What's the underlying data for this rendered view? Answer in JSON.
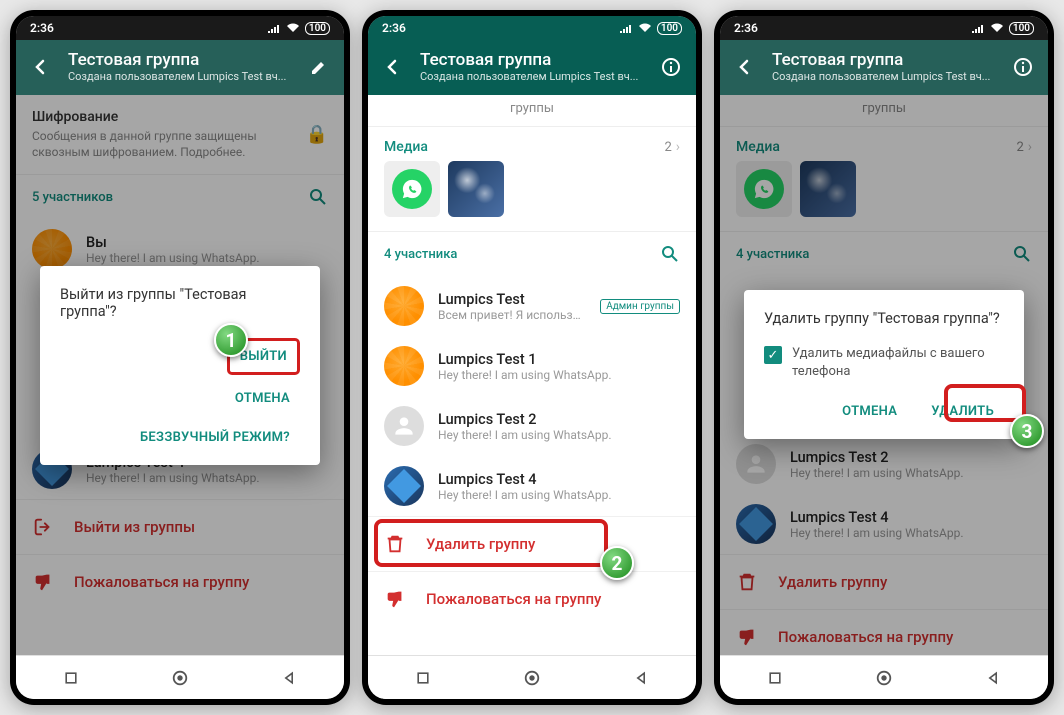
{
  "status": {
    "time": "2:36"
  },
  "header": {
    "title": "Тестовая группа",
    "subtitle": "Создана пользователем Lumpics Test вч..."
  },
  "encryption": {
    "title": "Шифрование",
    "text": "Сообщения в данной группе защищены сквозным шифрованием. Подробнее."
  },
  "groupLabel": "группы",
  "media": {
    "label": "Медиа",
    "count": "2"
  },
  "participants5": "5 участников",
  "participants4": "4 участника",
  "members": {
    "you": {
      "name": "Вы",
      "status": "Hey there! I am using WhatsApp."
    },
    "test": {
      "name": "Lumpics Test",
      "status": "Всем привет! Я использую WhatsApp."
    },
    "admin": "Админ группы",
    "test1": {
      "name": "Lumpics Test 1",
      "status": "Hey there! I am using WhatsApp."
    },
    "test2": {
      "name": "Lumpics Test 2",
      "status": "Hey there! I am using WhatsApp."
    },
    "test4": {
      "name": "Lumpics Test 4",
      "status": "Hey there! I am using WhatsApp."
    }
  },
  "actions": {
    "exit": "Выйти из группы",
    "delete": "Удалить группу",
    "report": "Пожаловаться на группу"
  },
  "dialog1": {
    "text": "Выйти из группы \"Тестовая группа\"?",
    "exit": "ВЫЙТИ",
    "cancel": "ОТМЕНА",
    "mute": "БЕЗЗВУЧНЫЙ РЕЖИМ?"
  },
  "dialog3": {
    "text": "Удалить группу \"Тестовая группа\"?",
    "check": "Удалить медиафайлы с вашего телефона",
    "cancel": "ОТМЕНА",
    "delete": "УДАЛИТЬ"
  },
  "steps": {
    "s1": "1",
    "s2": "2",
    "s3": "3"
  }
}
